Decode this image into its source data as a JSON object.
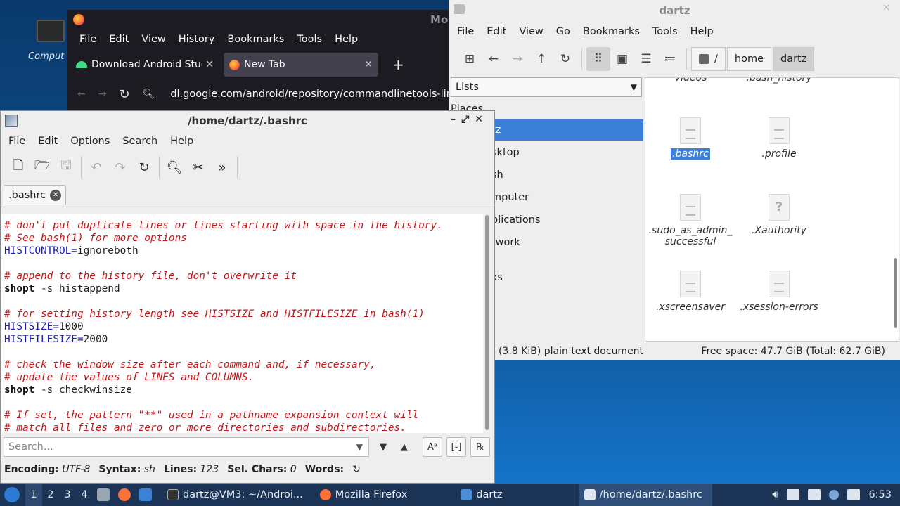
{
  "desktop": {
    "icon_label": "Comput"
  },
  "firefox": {
    "title": "Moz",
    "menu": [
      "File",
      "Edit",
      "View",
      "History",
      "Bookmarks",
      "Tools",
      "Help"
    ],
    "tabs": [
      {
        "label": "Download Android Studio"
      },
      {
        "label": "New Tab"
      }
    ],
    "url": "dl.google.com/android/repository/commandlinetools-lin"
  },
  "file_manager": {
    "title": "dartz",
    "menu": [
      "File",
      "Edit",
      "View",
      "Go",
      "Bookmarks",
      "Tools",
      "Help"
    ],
    "breadcrumbs": [
      "/",
      "home",
      "dartz"
    ],
    "side_combo": "Lists",
    "side_items": [
      "Places",
      "tz",
      "sktop",
      "sh",
      "mputer",
      "plications",
      "twork",
      "ks"
    ],
    "files": [
      {
        "name": "Videos",
        "icon": "folder"
      },
      {
        "name": ".bash_history",
        "icon": "document"
      },
      {
        "name": ".bashrc",
        "icon": "document",
        "selected": true
      },
      {
        "name": ".profile",
        "icon": "document"
      },
      {
        "name": ".sudo_as_admin_successful",
        "line1": ".sudo_as_admin_",
        "line2": "successful",
        "icon": "document"
      },
      {
        "name": ".Xauthority",
        "icon": "unknown"
      },
      {
        "name": ".xscreensaver",
        "icon": "document"
      },
      {
        "name": ".xsession-errors",
        "icon": "document"
      }
    ],
    "status_left": "(3.8 KiB) plain text document",
    "status_right": "Free space: 47.7 GiB (Total: 62.7 GiB)"
  },
  "editor": {
    "title": "/home/dartz/.bashrc",
    "menu": [
      "File",
      "Edit",
      "Options",
      "Search",
      "Help"
    ],
    "tab_label": ".bashrc",
    "lines": [
      [
        {
          "t": "# don't put duplicate lines or lines starting with space in the history.",
          "c": "cmt"
        }
      ],
      [
        {
          "t": "# See bash(1) for more options",
          "c": "cmt"
        }
      ],
      [
        {
          "t": "HISTCONTROL=",
          "c": "var"
        },
        {
          "t": "ignoreboth",
          "c": ""
        }
      ],
      [],
      [
        {
          "t": "# append to the history file, don't overwrite it",
          "c": "cmt"
        }
      ],
      [
        {
          "t": "shopt",
          "c": "kw"
        },
        {
          "t": " -s histappend",
          "c": ""
        }
      ],
      [],
      [
        {
          "t": "# for setting history length see HISTSIZE and HISTFILESIZE in bash(1)",
          "c": "cmt"
        }
      ],
      [
        {
          "t": "HISTSIZE=",
          "c": "var"
        },
        {
          "t": "1000",
          "c": ""
        }
      ],
      [
        {
          "t": "HISTFILESIZE=",
          "c": "var"
        },
        {
          "t": "2000",
          "c": ""
        }
      ],
      [],
      [
        {
          "t": "# check the window size after each command and, if necessary,",
          "c": "cmt"
        }
      ],
      [
        {
          "t": "# update the values of LINES and COLUMNS.",
          "c": "cmt"
        }
      ],
      [
        {
          "t": "shopt",
          "c": "kw"
        },
        {
          "t": " -s checkwinsize",
          "c": ""
        }
      ],
      [],
      [
        {
          "t": "# If set, the pattern \"**\" used in a pathname expansion context will",
          "c": "cmt"
        }
      ],
      [
        {
          "t": "# match all files and zero or more directories and subdirectories.",
          "c": "cmt"
        }
      ]
    ],
    "search_placeholder": "Search...",
    "status": {
      "encoding_label": "Encoding:",
      "encoding": "UTF-8",
      "syntax_label": "Syntax:",
      "syntax": "sh",
      "lines_label": "Lines:",
      "lines": "123",
      "sel_label": "Sel. Chars:",
      "sel": "0",
      "words_label": "Words:"
    }
  },
  "taskbar": {
    "workspaces": [
      "1",
      "2",
      "3",
      "4"
    ],
    "tasks": [
      {
        "label": "dartz@VM3: ~/Androi...",
        "icon": "terminal-icon"
      },
      {
        "label": "Mozilla Firefox",
        "icon": "firefox-icon"
      },
      {
        "label": "dartz",
        "icon": "folder-icon"
      },
      {
        "label": "/home/dartz/.bashrc",
        "icon": "editor-icon",
        "active": true
      }
    ],
    "clock": "6:53"
  }
}
